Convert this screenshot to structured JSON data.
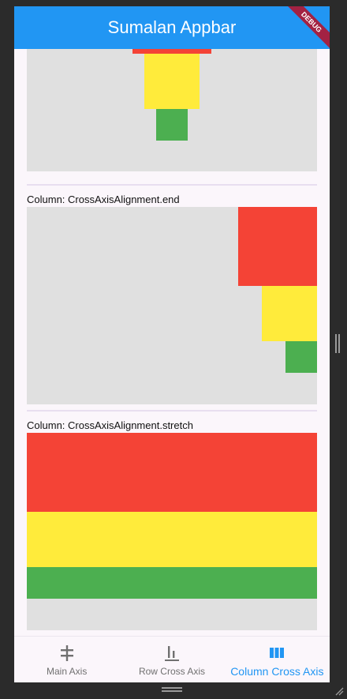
{
  "appbar": {
    "title": "Sumalan Appbar",
    "debug_banner": "DEBUG"
  },
  "sections": [
    {
      "label": "Column: CrossAxisAlignment.end"
    },
    {
      "label": "Column: CrossAxisAlignment.stretch"
    }
  ],
  "bottom_nav": {
    "items": [
      {
        "label": "Main Axis",
        "icon": "main-axis-icon"
      },
      {
        "label": "Row Cross Axis",
        "icon": "row-cross-axis-icon"
      },
      {
        "label": "Column Cross Axis",
        "icon": "column-cross-axis-icon"
      }
    ],
    "active_index": 2
  },
  "colors": {
    "appbar": "#2196f3",
    "red": "#f44336",
    "yellow": "#ffeb3b",
    "green": "#4caf50",
    "panel": "#e0e0e0",
    "active": "#2196f3",
    "inactive": "#707070"
  }
}
